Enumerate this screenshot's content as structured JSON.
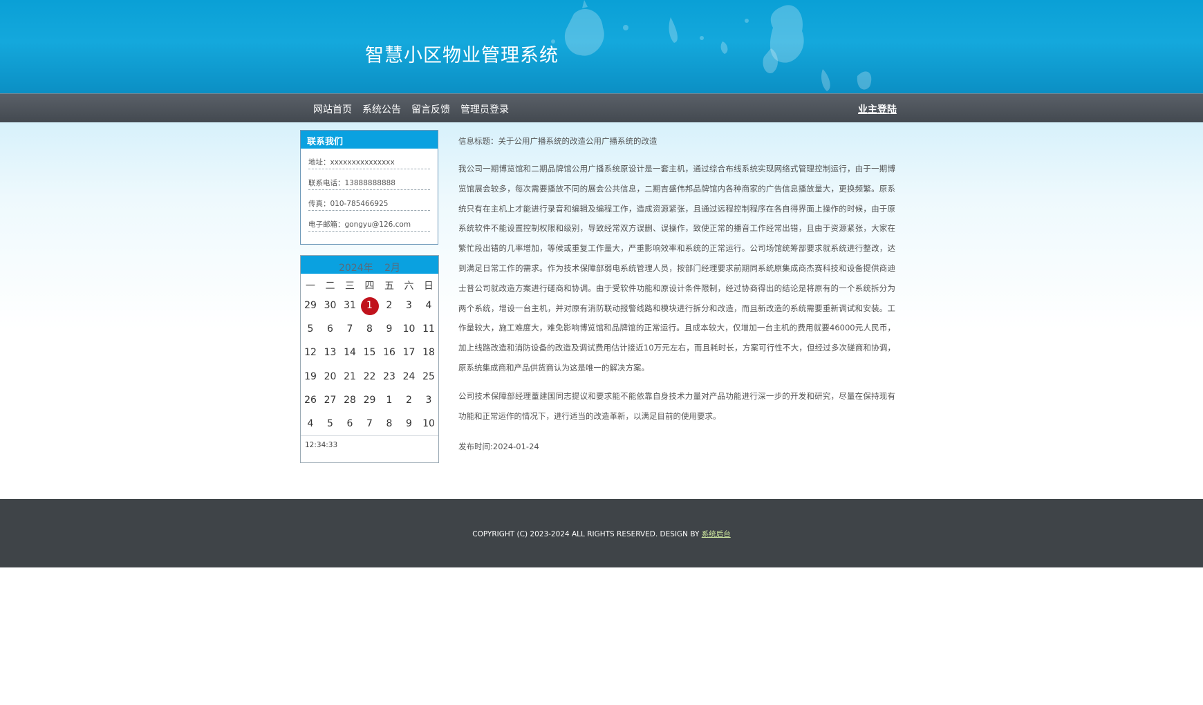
{
  "header": {
    "site_title": "智慧小区物业管理系统"
  },
  "nav": {
    "items": [
      "网站首页",
      "系统公告",
      "留言反馈",
      "管理员登录"
    ],
    "login": "业主登陆"
  },
  "contact": {
    "title": "联系我们",
    "rows": [
      "地址：xxxxxxxxxxxxxxx",
      "联系电话：13888888888",
      "传真：010-785466925",
      "电子邮箱：gongyu@126.com"
    ]
  },
  "calendar": {
    "year_label": "2024年",
    "month_label": "2月",
    "weekdays": [
      "一",
      "二",
      "三",
      "四",
      "五",
      "六",
      "日"
    ],
    "weeks": [
      [
        "29",
        "30",
        "31",
        "1",
        "2",
        "3",
        "4"
      ],
      [
        "5",
        "6",
        "7",
        "8",
        "9",
        "10",
        "11"
      ],
      [
        "12",
        "13",
        "14",
        "15",
        "16",
        "17",
        "18"
      ],
      [
        "19",
        "20",
        "21",
        "22",
        "23",
        "24",
        "25"
      ],
      [
        "26",
        "27",
        "28",
        "29",
        "1",
        "2",
        "3"
      ],
      [
        "4",
        "5",
        "6",
        "7",
        "8",
        "9",
        "10"
      ]
    ],
    "today": "1",
    "time": "12:34:33",
    "today_color": "#c0121c"
  },
  "article": {
    "title": "信息标题：关于公用广播系统的改造公用广播系统的改造",
    "para1": "我公司一期博览馆和二期品牌馆公用广播系统原设计是一套主机，通过综合布线系统实现网络式管理控制运行，由于一期博览馆展会较多，每次需要播放不同的展会公共信息，二期吉盛伟邦品牌馆内各种商家的广告信息播放量大，更换频繁。原系统只有在主机上才能进行录音和编辑及编程工作，造成资源紧张，且通过远程控制程序在各自得界面上操作的时候，由于原系统软件不能设置控制权限和级别，导致经常双方误删、误操作，致使正常的播音工作经常出错，且由于资源紧张，大家在繁忙段出错的几率增加，等候或重复工作量大，严重影响效率和系统的正常运行。公司场馆统筹部要求就系统进行整改，达到满足日常工作的需求。作为技术保障部弱电系统管理人员，按部门经理要求前期同系统原集成商杰赛科技和设备提供商迪士普公司就改造方案进行磋商和协调。由于受软件功能和原设计条件限制，经过协商得出的结论是将原有的一个系统拆分为两个系统，增设一台主机，并对原有消防联动报警线路和模块进行拆分和改造，而且新改造的系统需要重新调试和安装。工作量较大，施工难度大，难免影响博览馆和品牌馆的正常运行。且成本较大，仅增加一台主机的费用就要46000元人民币，加上线路改造和消防设备的改造及调试费用估计接近10万元左右，而且耗时长，方案可行性不大，但经过多次磋商和协调，原系统集成商和产品供货商认为这是唯一的解决方案。",
    "para2": "公司技术保障部经理蕫建国同志提议和要求能不能依靠自身技术力量对产品功能进行深一步的开发和研究，尽量在保持现有功能和正常运作的情况下，进行适当的改造革新，以满足目前的使用要求。",
    "publish_time": "发布时间:2024-01-24"
  },
  "footer": {
    "copyright": "COPYRIGHT (C) 2023-2024 ALL RIGHTS RESERVED. DESIGN BY ",
    "link": "系统后台"
  }
}
